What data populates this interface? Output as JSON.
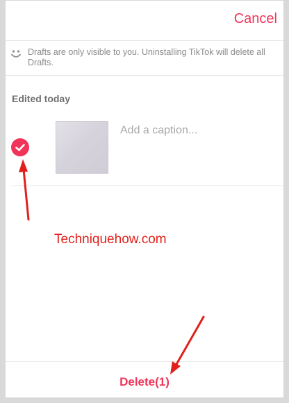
{
  "header": {
    "cancel_label": "Cancel"
  },
  "notice": {
    "icon": "smile-icon",
    "text": "Drafts are only visible to you. Uninstalling TikTok will delete all Drafts."
  },
  "drafts": {
    "section_label": "Edited today",
    "items": [
      {
        "selected": true,
        "caption_placeholder": "Add a caption..."
      }
    ]
  },
  "watermark": "Techniquehow.com",
  "footer": {
    "delete_label": "Delete(1)"
  },
  "colors": {
    "accent": "#f0345a",
    "annotation": "#e0201b"
  }
}
